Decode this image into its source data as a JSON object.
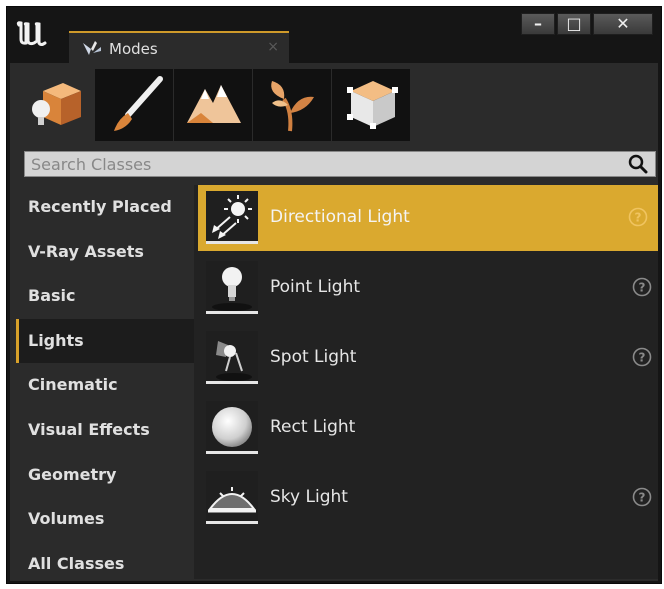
{
  "window": {
    "tab_label": "Modes",
    "tab_close": "×",
    "minimize": "–",
    "maximize": "□",
    "close": "✕"
  },
  "modes": [
    {
      "name": "place-mode",
      "active": true
    },
    {
      "name": "paint-mode",
      "active": false
    },
    {
      "name": "landscape-mode",
      "active": false
    },
    {
      "name": "foliage-mode",
      "active": false
    },
    {
      "name": "geometry-mode",
      "active": false
    }
  ],
  "search": {
    "placeholder": "Search Classes",
    "value": ""
  },
  "sidebar": {
    "items": [
      {
        "label": "Recently Placed"
      },
      {
        "label": "V-Ray Assets"
      },
      {
        "label": "Basic"
      },
      {
        "label": "Lights",
        "active": true
      },
      {
        "label": "Cinematic"
      },
      {
        "label": "Visual Effects"
      },
      {
        "label": "Geometry"
      },
      {
        "label": "Volumes"
      },
      {
        "label": "All Classes"
      }
    ]
  },
  "list": {
    "items": [
      {
        "label": "Directional Light",
        "icon": "directional-light-icon",
        "help": true,
        "selected": true
      },
      {
        "label": "Point Light",
        "icon": "point-light-icon",
        "help": true
      },
      {
        "label": "Spot Light",
        "icon": "spot-light-icon",
        "help": true
      },
      {
        "label": "Rect Light",
        "icon": "rect-light-icon",
        "help": false
      },
      {
        "label": "Sky Light",
        "icon": "sky-light-icon",
        "help": true
      }
    ]
  },
  "colors": {
    "accent": "#daa92f",
    "background": "#2b2b2b",
    "list_background": "#222222"
  }
}
